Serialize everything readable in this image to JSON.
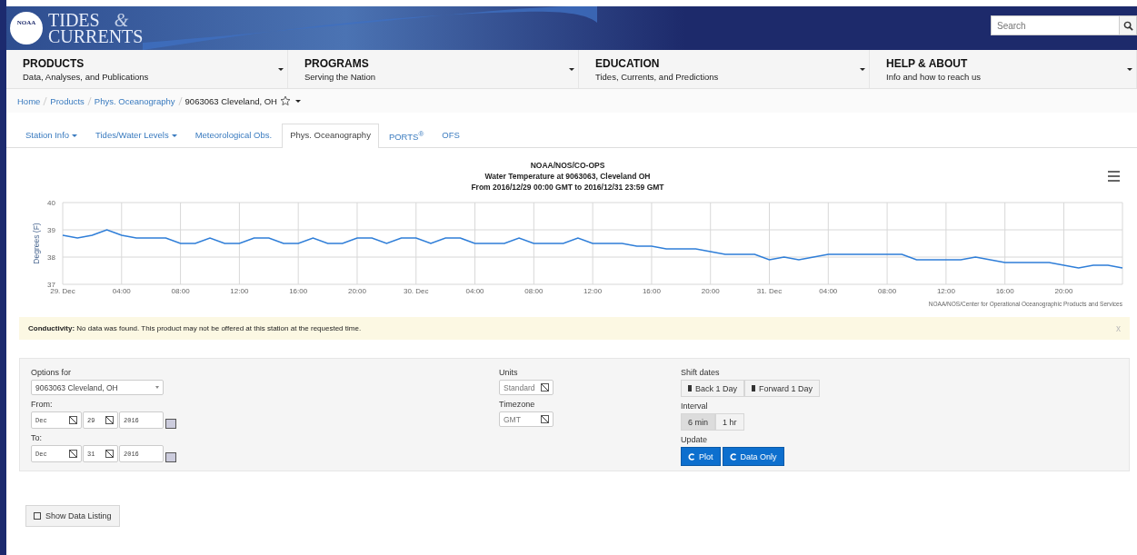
{
  "header": {
    "logo_badge": "NOAA",
    "logo_top": "TIDES",
    "logo_amp": "&",
    "logo_bottom": "CURRENTS",
    "search": {
      "placeholder": "Search"
    }
  },
  "nav": [
    {
      "title": "PRODUCTS",
      "subtitle": "Data, Analyses, and Publications"
    },
    {
      "title": "PROGRAMS",
      "subtitle": "Serving the Nation"
    },
    {
      "title": "EDUCATION",
      "subtitle": "Tides, Currents, and Predictions"
    },
    {
      "title": "HELP & ABOUT",
      "subtitle": "Info and how to reach us"
    }
  ],
  "breadcrumb": {
    "links": [
      "Home",
      "Products",
      "Phys. Oceanography"
    ],
    "current": "9063063 Cleveland, OH"
  },
  "tabs": [
    {
      "label": "Station Info",
      "dropdown": true,
      "selected": false
    },
    {
      "label": "Tides/Water Levels",
      "dropdown": true,
      "selected": false
    },
    {
      "label": "Meteorological Obs.",
      "dropdown": false,
      "selected": false
    },
    {
      "label": "Phys. Oceanography",
      "dropdown": false,
      "selected": true
    },
    {
      "label": "PORTS$^{®}$",
      "dropdown": false,
      "selected": false
    },
    {
      "label": "OFS",
      "dropdown": false,
      "selected": false
    }
  ],
  "chart": {
    "date_range": "From 2016/12/29 00:00 GMT to 2016/12/31 23:59 GMT",
    "credit": "NOAA/NOS/Center for Operational Oceanographic Products and Services",
    "chart_data": {
      "type": "line",
      "title": "NOAA/NOS/CO-OPS",
      "subtitle": "Water Temperature at 9063063, Cleveland OH",
      "ylabel": "Degrees (F)",
      "grid": true,
      "x": [
        "2016-12-29T00:00",
        "2016-12-29T01:00",
        "2016-12-29T02:00",
        "2016-12-29T03:00",
        "2016-12-29T04:00",
        "2016-12-29T05:00",
        "2016-12-29T06:00",
        "2016-12-29T07:00",
        "2016-12-29T08:00",
        "2016-12-29T09:00",
        "2016-12-29T10:00",
        "2016-12-29T11:00",
        "2016-12-29T12:00",
        "2016-12-29T13:00",
        "2016-12-29T14:00",
        "2016-12-29T15:00",
        "2016-12-29T16:00",
        "2016-12-29T17:00",
        "2016-12-29T18:00",
        "2016-12-29T19:00",
        "2016-12-29T20:00",
        "2016-12-29T21:00",
        "2016-12-29T22:00",
        "2016-12-29T23:00",
        "2016-12-30T00:00",
        "2016-12-30T01:00",
        "2016-12-30T02:00",
        "2016-12-30T03:00",
        "2016-12-30T04:00",
        "2016-12-30T05:00",
        "2016-12-30T06:00",
        "2016-12-30T07:00",
        "2016-12-30T08:00",
        "2016-12-30T09:00",
        "2016-12-30T10:00",
        "2016-12-30T11:00",
        "2016-12-30T12:00",
        "2016-12-30T13:00",
        "2016-12-30T14:00",
        "2016-12-30T15:00",
        "2016-12-30T16:00",
        "2016-12-30T17:00",
        "2016-12-30T18:00",
        "2016-12-30T19:00",
        "2016-12-30T20:00",
        "2016-12-30T21:00",
        "2016-12-30T22:00",
        "2016-12-30T23:00",
        "2016-12-31T00:00",
        "2016-12-31T01:00",
        "2016-12-31T02:00",
        "2016-12-31T03:00",
        "2016-12-31T04:00",
        "2016-12-31T05:00",
        "2016-12-31T06:00",
        "2016-12-31T07:00",
        "2016-12-31T08:00",
        "2016-12-31T09:00",
        "2016-12-31T10:00",
        "2016-12-31T11:00",
        "2016-12-31T12:00",
        "2016-12-31T13:00",
        "2016-12-31T14:00",
        "2016-12-31T15:00",
        "2016-12-31T16:00",
        "2016-12-31T17:00",
        "2016-12-31T18:00",
        "2016-12-31T19:00",
        "2016-12-31T20:00",
        "2016-12-31T21:00",
        "2016-12-31T22:00",
        "2016-12-31T23:00",
        "2016-12-31T23:59"
      ],
      "series": [
        {
          "color": "#2f7ed8",
          "values": [
            38.8,
            38.7,
            38.8,
            39.0,
            38.8,
            38.7,
            38.7,
            38.7,
            38.5,
            38.5,
            38.7,
            38.5,
            38.5,
            38.7,
            38.7,
            38.5,
            38.5,
            38.7,
            38.5,
            38.5,
            38.7,
            38.7,
            38.5,
            38.7,
            38.7,
            38.5,
            38.7,
            38.7,
            38.5,
            38.5,
            38.5,
            38.7,
            38.5,
            38.5,
            38.5,
            38.7,
            38.5,
            38.5,
            38.5,
            38.4,
            38.4,
            38.3,
            38.3,
            38.3,
            38.2,
            38.1,
            38.1,
            38.1,
            37.9,
            38.0,
            37.9,
            38.0,
            38.1,
            38.1,
            38.1,
            38.1,
            38.1,
            38.1,
            37.9,
            37.9,
            37.9,
            37.9,
            38.0,
            37.9,
            37.8,
            37.8,
            37.8,
            37.8,
            37.7,
            37.6,
            37.7,
            37.7,
            37.6
          ]
        }
      ],
      "xlim": [
        "2016-12-29T00:00",
        "2016-12-31T23:59"
      ],
      "ylim": [
        37,
        40
      ],
      "yticks": [
        37,
        38,
        39,
        40
      ],
      "xticks": [
        {
          "value": "2016-12-29T00:00",
          "label": "29. Dec"
        },
        {
          "value": "2016-12-29T04:00",
          "label": "04:00"
        },
        {
          "value": "2016-12-29T08:00",
          "label": "08:00"
        },
        {
          "value": "2016-12-29T12:00",
          "label": "12:00"
        },
        {
          "value": "2016-12-29T16:00",
          "label": "16:00"
        },
        {
          "value": "2016-12-29T20:00",
          "label": "20:00"
        },
        {
          "value": "2016-12-30T00:00",
          "label": "30. Dec"
        },
        {
          "value": "2016-12-30T04:00",
          "label": "04:00"
        },
        {
          "value": "2016-12-30T08:00",
          "label": "08:00"
        },
        {
          "value": "2016-12-30T12:00",
          "label": "12:00"
        },
        {
          "value": "2016-12-30T16:00",
          "label": "16:00"
        },
        {
          "value": "2016-12-30T20:00",
          "label": "20:00"
        },
        {
          "value": "2016-12-31T00:00",
          "label": "31. Dec"
        },
        {
          "value": "2016-12-31T04:00",
          "label": "04:00"
        },
        {
          "value": "2016-12-31T08:00",
          "label": "08:00"
        },
        {
          "value": "2016-12-31T12:00",
          "label": "12:00"
        },
        {
          "value": "2016-12-31T16:00",
          "label": "16:00"
        },
        {
          "value": "2016-12-31T20:00",
          "label": "20:00"
        }
      ]
    }
  },
  "alert": {
    "text": "**Conductivity:** No data was found. This product may not be offered at this station at the requested time.",
    "close": "x"
  },
  "options": {
    "station_label": "Options for",
    "station": "9063063 Cleveland, OH",
    "from_label": "From:",
    "from": {
      "month": "Dec",
      "day": "29",
      "year": "2016"
    },
    "to_label": "To:",
    "to": {
      "month": "Dec",
      "day": "31",
      "year": "2016"
    },
    "units_label": "Units",
    "units": "Standard",
    "timezone_label": "Timezone",
    "timezone": "GMT",
    "shift_label": "Shift dates",
    "shift_buttons": [
      "Back 1 Day",
      "Forward 1 Day"
    ],
    "interval_label": "Interval",
    "intervals": [
      {
        "label": "6 min",
        "selected": true
      },
      {
        "label": "1 hr",
        "selected": false
      }
    ],
    "update_label": "Update",
    "update_buttons": [
      "Plot",
      "Data Only"
    ]
  },
  "show_data_button": "Show Data Listing"
}
